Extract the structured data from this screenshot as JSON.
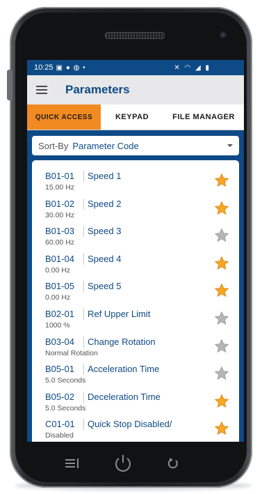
{
  "statusbar": {
    "time": "10:25",
    "left_icons": "▣ ● ◍ •",
    "right_icons": "✕ ◠ ◢ ▮"
  },
  "appbar": {
    "title": "Parameters"
  },
  "tabs": [
    {
      "label": "QUICK ACCESS",
      "active": true
    },
    {
      "label": "KEYPAD",
      "active": false
    },
    {
      "label": "FILE MANAGER",
      "active": false
    }
  ],
  "sort": {
    "label": "Sort-By",
    "value": "Parameter Code"
  },
  "colors": {
    "primary": "#0e4a86",
    "accent": "#f18a21",
    "star_on": "#f5a623",
    "star_off": "#b5b5b5"
  },
  "parameters": [
    {
      "code": "B01-01",
      "name": "Speed 1",
      "value": "15.00 Hz",
      "favorite": true
    },
    {
      "code": "B01-02",
      "name": "Speed 2",
      "value": "30.00 Hz",
      "favorite": true
    },
    {
      "code": "B01-03",
      "name": "Speed 3",
      "value": "60.00 Hz",
      "favorite": false
    },
    {
      "code": "B01-04",
      "name": "Speed 4",
      "value": "0.00 Hz",
      "favorite": true
    },
    {
      "code": "B01-05",
      "name": "Speed 5",
      "value": "0.00 Hz",
      "favorite": true
    },
    {
      "code": "B02-01",
      "name": "Ref Upper Limit",
      "value": "1000 %",
      "favorite": false
    },
    {
      "code": "B03-04",
      "name": "Change Rotation",
      "value": "Normal Rotation",
      "favorite": false
    },
    {
      "code": "B05-01",
      "name": "Acceleration Time",
      "value": "5.0 Seconds",
      "favorite": false
    },
    {
      "code": "B05-02",
      "name": "Deceleration Time",
      "value": "5.0 Seconds",
      "favorite": true
    },
    {
      "code": "C01-01",
      "name": "Quick Stop Disabled/",
      "value": "Disabled",
      "favorite": true
    }
  ]
}
